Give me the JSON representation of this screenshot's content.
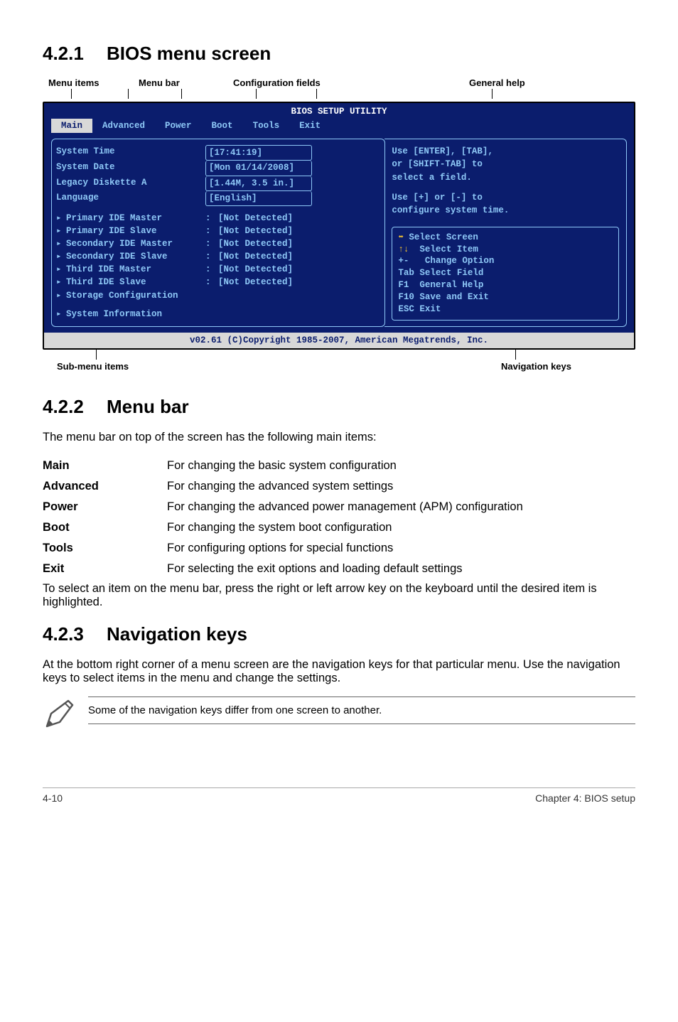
{
  "section_421": {
    "num": "4.2.1",
    "title": "BIOS menu screen"
  },
  "top_labels": {
    "menu_items": "Menu items",
    "menu_bar": "Menu bar",
    "config_fields": "Configuration fields",
    "general_help": "General help"
  },
  "bios": {
    "title": "BIOS SETUP UTILITY",
    "tabs": [
      "Main",
      "Advanced",
      "Power",
      "Boot",
      "Tools",
      "Exit"
    ],
    "fields": {
      "system_time_k": "System Time",
      "system_time_v": "[17:41:19]",
      "system_date_k": "System Date",
      "system_date_v": "[Mon 01/14/2008]",
      "legacy_k": "Legacy Diskette A",
      "legacy_v": "[1.44M, 3.5 in.]",
      "lang_k": "Language",
      "lang_v": "[English]",
      "pim_k": "Primary IDE Master",
      "pim_v": "[Not Detected]",
      "pis_k": "Primary IDE Slave",
      "pis_v": "[Not Detected]",
      "sim_k": "Secondary IDE Master",
      "sim_v": "[Not Detected]",
      "sis_k": "Secondary IDE Slave",
      "sis_v": "[Not Detected]",
      "tim_k": "Third IDE Master",
      "tim_v": "[Not Detected]",
      "tis_k": "Third IDE Slave",
      "tis_v": "[Not Detected]",
      "storage_k": "Storage Configuration",
      "sysinfo_k": "System Information"
    },
    "help": {
      "l1": "Use [ENTER], [TAB],",
      "l2": "or [SHIFT-TAB] to",
      "l3": "select a field.",
      "l4": "Use [+] or [-] to",
      "l5": "configure system time."
    },
    "legend": {
      "l1a": "⬌",
      "l1b": " Select Screen",
      "l2a": "↑↓",
      "l2b": "  Select Item",
      "l3": "+-   Change Option",
      "l4": "Tab Select Field",
      "l5": "F1  General Help",
      "l6": "F10 Save and Exit",
      "l7": "ESC Exit"
    },
    "footer": "v02.61 (C)Copyright 1985-2007, American Megatrends, Inc."
  },
  "bottom_labels": {
    "sub_menu": "Sub-menu items",
    "nav_keys": "Navigation keys"
  },
  "section_422": {
    "num": "4.2.2",
    "title": "Menu bar"
  },
  "menubar_intro": "The menu bar on top of the screen has the following main items:",
  "defs": {
    "main_k": "Main",
    "main_v": "For changing the basic system configuration",
    "adv_k": "Advanced",
    "adv_v": "For changing the advanced system settings",
    "pow_k": "Power",
    "pow_v": "For changing the advanced power management (APM) configuration",
    "boot_k": "Boot",
    "boot_v": "For changing the system boot configuration",
    "tools_k": "Tools",
    "tools_v": "For configuring options for special functions",
    "exit_k": "Exit",
    "exit_v": "For selecting the exit options and loading default settings"
  },
  "menubar_outro": "To select an item on the menu bar, press the right or left arrow key on the keyboard until the desired item is highlighted.",
  "section_423": {
    "num": "4.2.3",
    "title": "Navigation keys"
  },
  "navkeys_text": "At the bottom right corner of a menu screen are the navigation keys for that particular menu. Use the navigation keys to select items in the menu and change the settings.",
  "note_text": "Some of the navigation keys differ from one screen to another.",
  "footer": {
    "left": "4-10",
    "right": "Chapter 4: BIOS setup"
  }
}
